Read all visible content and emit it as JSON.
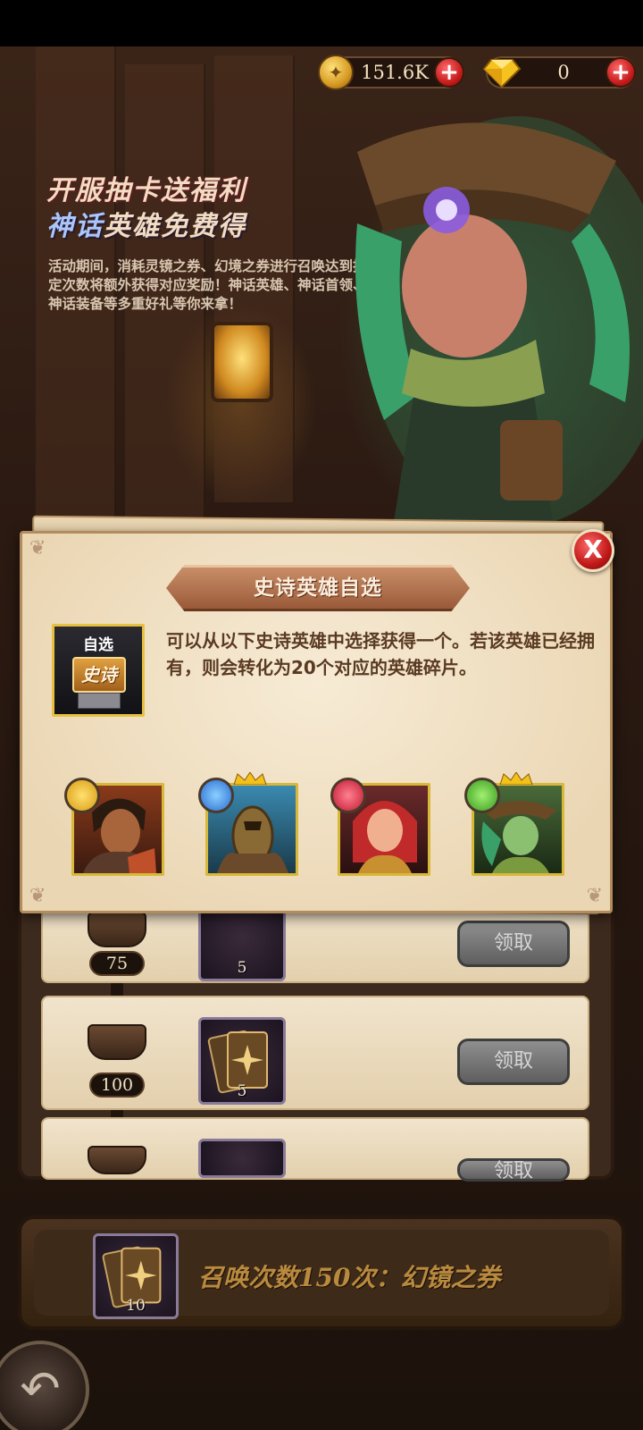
{
  "currency": {
    "gold_value": "151.6K",
    "gem_value": "0"
  },
  "banner": {
    "title_line1": "开服抽卡送福利",
    "title_line2_highlight": "神话",
    "title_line2_rest": "英雄免费得",
    "description": "活动期间，消耗灵镜之券、幻境之券进行召唤达到指定次数将额外获得对应奖励！神话英雄、神话首领、神话装备等多重好礼等你来拿！"
  },
  "milestones": {
    "items": [
      {
        "count": "75",
        "reward_qty": "5",
        "claim_label": "领取"
      },
      {
        "count": "100",
        "reward_qty": "5",
        "claim_label": "领取"
      },
      {
        "count": "",
        "reward_qty": "",
        "claim_label": "领取"
      }
    ]
  },
  "summon_bar": {
    "ticket_qty": "10",
    "text": "召唤次数150次：幻镜之券"
  },
  "dialog": {
    "title": "史诗英雄自选",
    "box_label": "自选",
    "box_badge": "史诗",
    "description": "可以从以下史诗英雄中选择获得一个。若该英雄已经拥有，则会转化为20个对应的英雄碎片。",
    "close_label": "X",
    "heroes": [
      {
        "element": "light",
        "element_color": "#f2c21a",
        "crowned": false
      },
      {
        "element": "water",
        "element_color": "#3a8ee6",
        "crowned": true
      },
      {
        "element": "fire",
        "element_color": "#e6384a",
        "crowned": false
      },
      {
        "element": "nature",
        "element_color": "#52c23a",
        "crowned": true
      }
    ]
  },
  "colors": {
    "accent_gold": "#d8b838",
    "close_red": "#c01818",
    "dialog_bg": "#f3e4c8"
  }
}
